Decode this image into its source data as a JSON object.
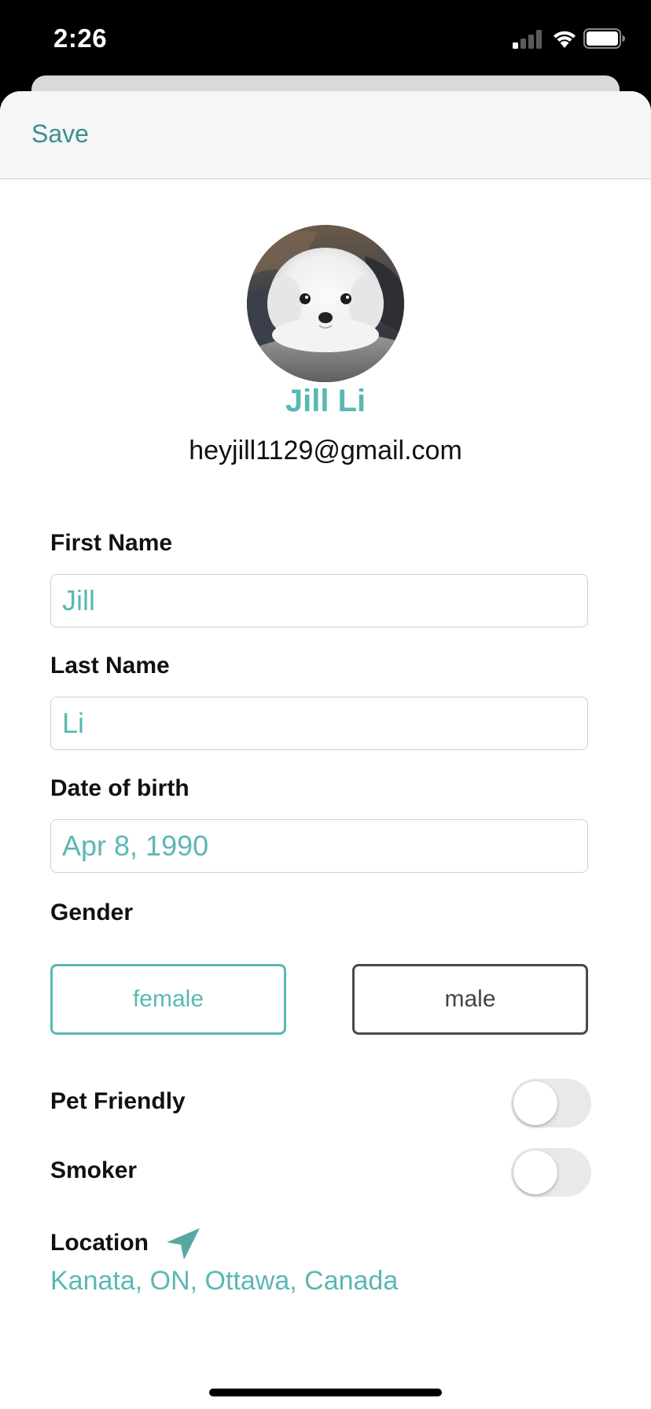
{
  "status_bar": {
    "time": "2:26"
  },
  "nav": {
    "save_label": "Save"
  },
  "profile": {
    "name": "Jill Li",
    "email": "heyjill1129@gmail.com",
    "avatar_alt": "white dog"
  },
  "form": {
    "first_name": {
      "label": "First Name",
      "value": "Jill"
    },
    "last_name": {
      "label": "Last Name",
      "value": "Li"
    },
    "date_of_birth": {
      "label": "Date of birth",
      "value": "Apr 8, 1990"
    },
    "gender": {
      "label": "Gender",
      "options": [
        "female",
        "male"
      ],
      "selected": "female"
    },
    "pet_friendly": {
      "label": "Pet Friendly",
      "on": false
    },
    "smoker": {
      "label": "Smoker",
      "on": false
    },
    "location": {
      "label": "Location",
      "value": "Kanata, ON, Ottawa, Canada",
      "icon": "location-arrow-icon"
    }
  },
  "colors": {
    "accent": "#5ab8b4",
    "nav_text": "#3f8f8d",
    "toggle_off": "#e9e9eb"
  }
}
